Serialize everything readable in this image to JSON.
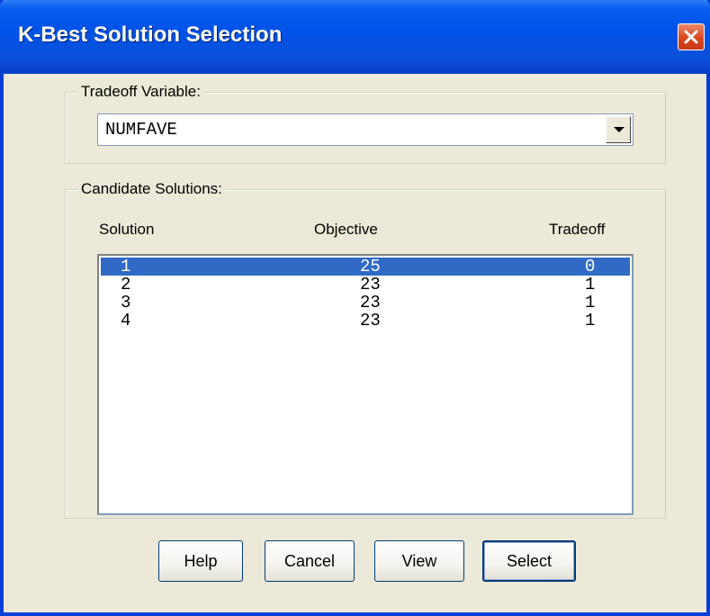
{
  "window": {
    "title": "K-Best Solution Selection"
  },
  "tradeoff_group": {
    "label": "Tradeoff Variable:",
    "selected_value": "NUMFAVE"
  },
  "candidates_group": {
    "label": "Candidate Solutions:",
    "columns": [
      "Solution",
      "Objective",
      "Tradeoff"
    ],
    "rows": [
      {
        "solution": "1",
        "objective": "25",
        "tradeoff": "0",
        "selected": true
      },
      {
        "solution": "2",
        "objective": "23",
        "tradeoff": "1",
        "selected": false
      },
      {
        "solution": "3",
        "objective": "23",
        "tradeoff": "1",
        "selected": false
      },
      {
        "solution": "4",
        "objective": "23",
        "tradeoff": "1",
        "selected": false
      }
    ]
  },
  "buttons": {
    "help": "Help",
    "cancel": "Cancel",
    "view": "View",
    "select": "Select"
  },
  "icons": {
    "close": "close-icon",
    "dropdown": "chevron-down-icon"
  },
  "colors": {
    "titlebar": "#0052e8",
    "selection": "#316ac5",
    "dialog_bg": "#ece9d8",
    "close_button": "#d9471f"
  }
}
